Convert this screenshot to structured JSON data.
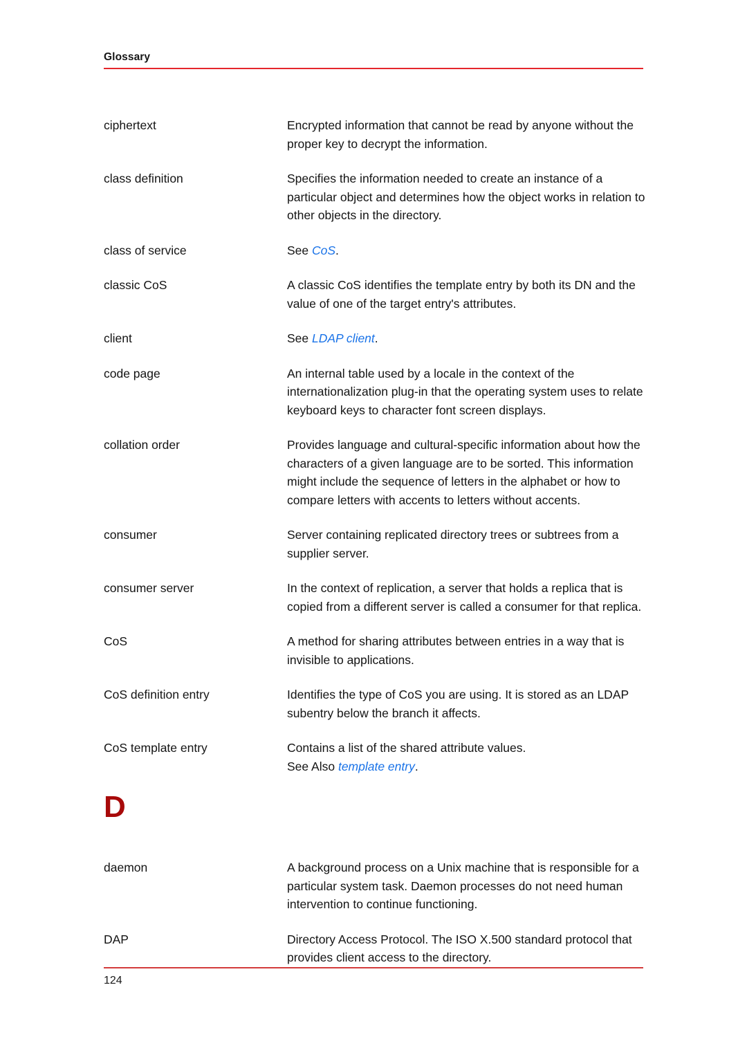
{
  "header": {
    "title": "Glossary"
  },
  "footer": {
    "page_number": "124"
  },
  "colors": {
    "header_rule": "#e5262b",
    "footer_rule": "#d33b3b",
    "section_letter": "#a80a0a",
    "cross_reference_link": "#1a73e8",
    "body_text": "#141414"
  },
  "entries": [
    {
      "term": "ciphertext",
      "definition": "Encrypted information that cannot be read by anyone without the proper key to decrypt the information."
    },
    {
      "term": "class definition",
      "definition": "Specifies the information needed to create an instance of a particular object and determines how the object works in relation to other objects in the directory."
    },
    {
      "term": "class of service",
      "definition_prefix": "See ",
      "definition_link": "CoS",
      "definition_suffix": "."
    },
    {
      "term": "classic CoS",
      "definition": "A classic CoS identifies the template entry by both its DN and the value of one of the target entry's attributes."
    },
    {
      "term": "client",
      "definition_prefix": "See ",
      "definition_link": "LDAP client",
      "definition_suffix": "."
    },
    {
      "term": "code page",
      "definition": "An internal table used by a locale in the context of the internationalization plug-in that the operating system uses to relate keyboard keys to character font screen displays."
    },
    {
      "term": "collation order",
      "definition": "Provides language and cultural-specific information about how the characters of a given language are to be sorted. This information might include the sequence of letters in the alphabet or how to compare letters with accents to letters without accents."
    },
    {
      "term": "consumer",
      "definition": "Server containing replicated directory trees or subtrees from a supplier server."
    },
    {
      "term": "consumer server",
      "definition": "In the context of replication, a server that holds a replica that is copied from a different server is called a consumer for that replica."
    },
    {
      "term": "CoS",
      "definition": "A method for sharing attributes between entries in a way that is invisible to applications."
    },
    {
      "term": "CoS definition entry",
      "definition": "Identifies the type of CoS you are using. It is stored as an LDAP subentry below the branch it affects."
    },
    {
      "term": "CoS template entry",
      "definition": "Contains a list of the shared attribute values.",
      "definition_prefix": "See Also ",
      "definition_link": "template entry",
      "definition_suffix": "."
    }
  ],
  "section": {
    "letter": "D"
  },
  "entries_d": [
    {
      "term": "daemon",
      "definition": "A background process on a Unix machine that is responsible for a particular system task. Daemon processes do not need human intervention to continue functioning."
    },
    {
      "term": "DAP",
      "definition": "Directory Access Protocol. The ISO X.500 standard protocol that provides client access to the directory."
    }
  ]
}
